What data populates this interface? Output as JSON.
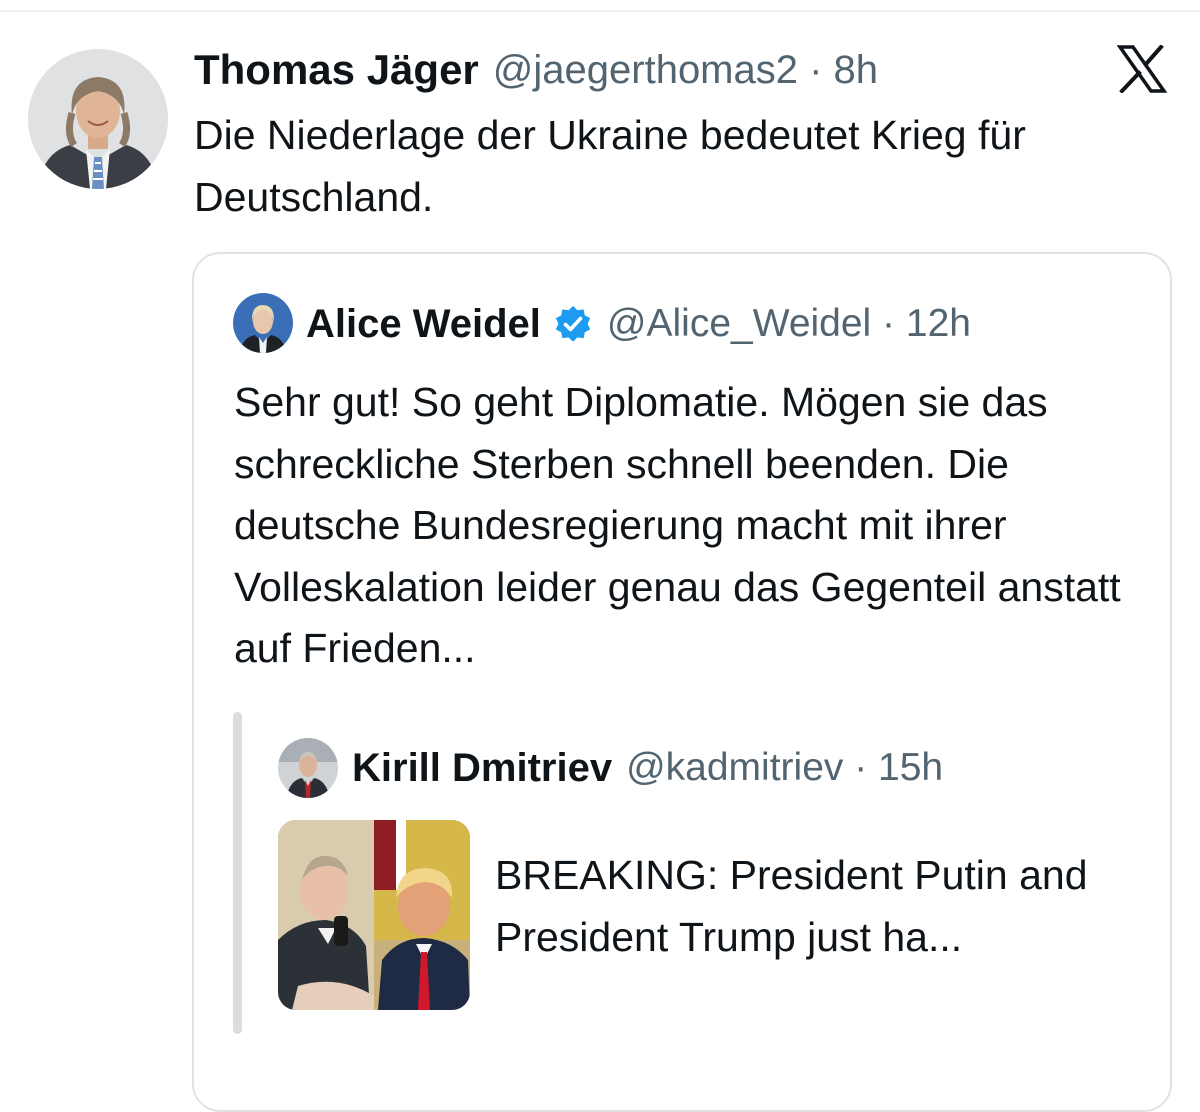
{
  "main_tweet": {
    "author_name": "Thomas Jäger",
    "handle_time": "@jaegerthomas2 · 8h",
    "text": "Die Niederlage der Ukraine bedeutet Krieg für Deutschland.",
    "logo_icon": "x-logo-icon"
  },
  "quoted_tweet": {
    "author_name": "Alice Weidel",
    "verified_icon": "verified-badge-icon",
    "verified_color": "#1d9bf0",
    "handle_time": "@Alice_Weidel · 12h",
    "text": "Sehr gut! So geht Diplomatie. Mögen sie das schreckliche Sterben schnell beenden. Die deutsche Bundesregierung macht mit ihrer Volleskalation leider genau das Gegenteil anstatt auf Frieden..."
  },
  "nested_quote": {
    "author_name": "Kirill Dmitriev",
    "handle_time": "@kadmitriev · 15h",
    "text": "BREAKING: President Putin and President Trump just ha..."
  },
  "colors": {
    "text_primary": "#0f1419",
    "text_secondary": "#536471",
    "border": "#dfe3e6"
  }
}
